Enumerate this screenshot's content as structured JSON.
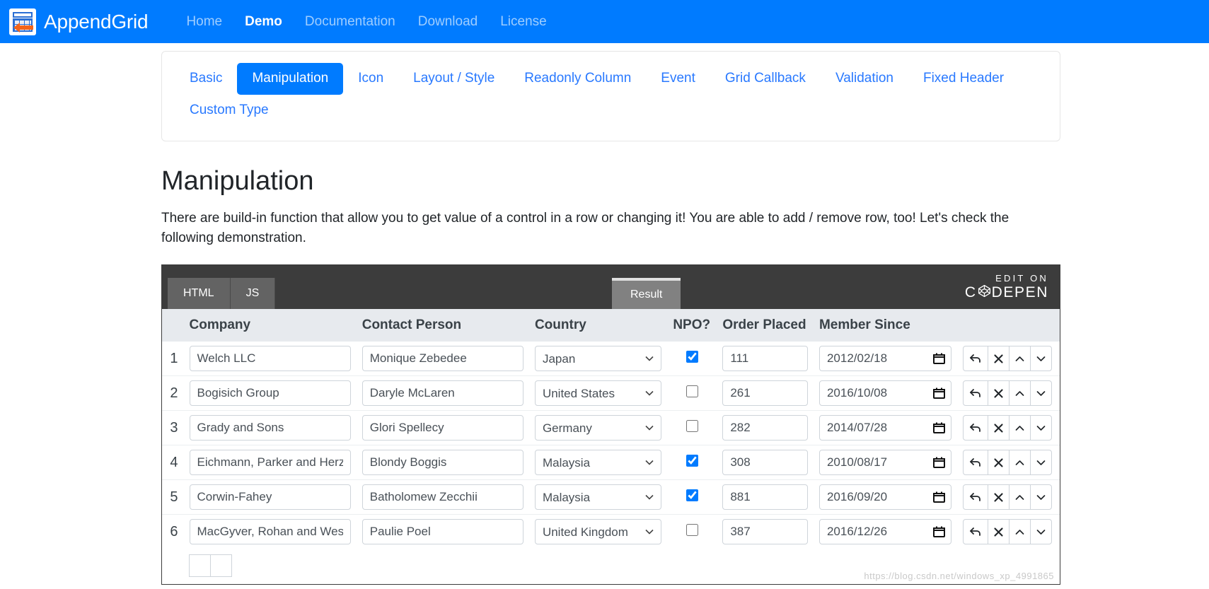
{
  "navbar": {
    "brand": "AppendGrid",
    "logo_icon": "appendgrid-logo-icon",
    "links": [
      {
        "label": "Home",
        "active": false
      },
      {
        "label": "Demo",
        "active": true
      },
      {
        "label": "Documentation",
        "active": false
      },
      {
        "label": "Download",
        "active": false
      },
      {
        "label": "License",
        "active": false
      }
    ]
  },
  "tabs": [
    {
      "label": "Basic",
      "active": false
    },
    {
      "label": "Manipulation",
      "active": true
    },
    {
      "label": "Icon",
      "active": false
    },
    {
      "label": "Layout / Style",
      "active": false
    },
    {
      "label": "Readonly Column",
      "active": false
    },
    {
      "label": "Event",
      "active": false
    },
    {
      "label": "Grid Callback",
      "active": false
    },
    {
      "label": "Validation",
      "active": false
    },
    {
      "label": "Fixed Header",
      "active": false
    },
    {
      "label": "Custom Type",
      "active": false
    }
  ],
  "section": {
    "title": "Manipulation",
    "description": "There are build-in function that allow you to get value of a control in a row or changing it! You are able to add / remove row, too! Let's check the following demonstration."
  },
  "codepen": {
    "tabs": [
      {
        "label": "HTML",
        "active": false
      },
      {
        "label": "JS",
        "active": false
      }
    ],
    "result_label": "Result",
    "edit_on": "EDIT ON",
    "codepen_before": "C",
    "codepen_after": "DEPEN",
    "logo_icon": "codepen-hexagon-icon"
  },
  "grid": {
    "columns": [
      "Company",
      "Contact Person",
      "Country",
      "NPO?",
      "Order Placed",
      "Member Since"
    ],
    "country_options": [
      "Japan",
      "United States",
      "Germany",
      "Malaysia",
      "United Kingdom"
    ],
    "rows": [
      {
        "num": "1",
        "company": "Welch LLC",
        "contact": "Monique Zebedee",
        "country": "Japan",
        "npo": true,
        "order": "111",
        "member": "2012/02/18"
      },
      {
        "num": "2",
        "company": "Bogisich Group",
        "contact": "Daryle McLaren",
        "country": "United States",
        "npo": false,
        "order": "261",
        "member": "2016/10/08"
      },
      {
        "num": "3",
        "company": "Grady and Sons",
        "contact": "Glori Spellecy",
        "country": "Germany",
        "npo": false,
        "order": "282",
        "member": "2014/07/28"
      },
      {
        "num": "4",
        "company": "Eichmann, Parker and Herzog",
        "contact": "Blondy Boggis",
        "country": "Malaysia",
        "npo": true,
        "order": "308",
        "member": "2010/08/17"
      },
      {
        "num": "5",
        "company": "Corwin-Fahey",
        "contact": "Batholomew Zecchii",
        "country": "Malaysia",
        "npo": true,
        "order": "881",
        "member": "2016/09/20"
      },
      {
        "num": "6",
        "company": "MacGyver, Rohan and West",
        "contact": "Paulie Poel",
        "country": "United Kingdom",
        "npo": false,
        "order": "387",
        "member": "2016/12/26"
      }
    ],
    "row_actions": [
      {
        "icon": "undo-icon",
        "glyph": "↩"
      },
      {
        "icon": "remove-row-icon",
        "glyph": "✖"
      },
      {
        "icon": "move-up-icon",
        "glyph": "⌃"
      },
      {
        "icon": "move-down-icon",
        "glyph": "⌄"
      }
    ]
  },
  "watermark": "https://blog.csdn.net/windows_xp_4991865"
}
